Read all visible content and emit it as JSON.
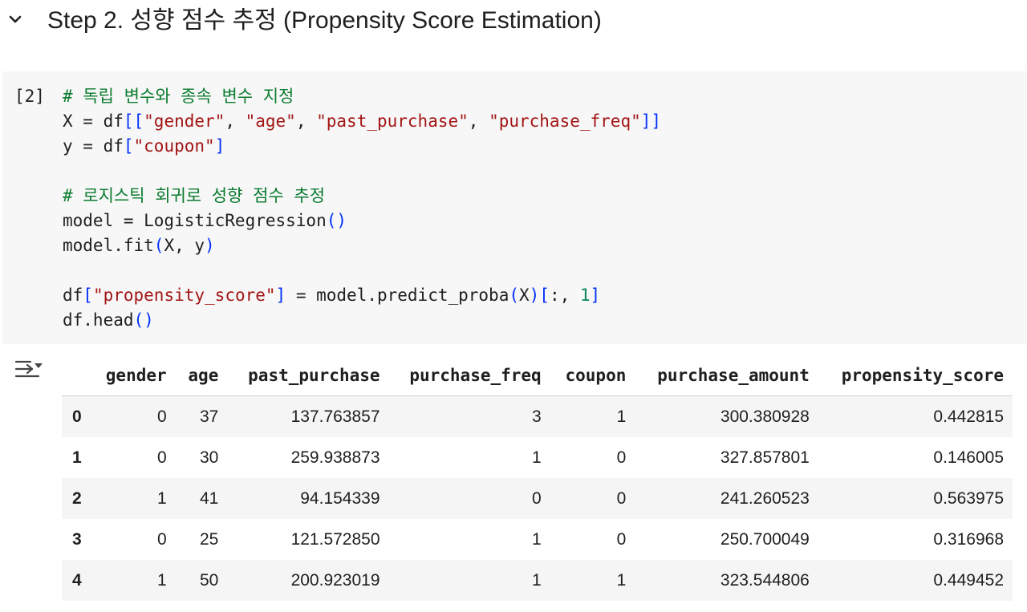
{
  "section": {
    "toggle_icon": "chevron-down-icon",
    "title": "Step 2. 성향 점수 추정 (Propensity Score Estimation)"
  },
  "code_cell": {
    "execution_count": "[2]",
    "lines": [
      [
        {
          "t": "# 독립 변수와 종속 변수 지정",
          "k": "comment"
        }
      ],
      [
        {
          "t": "X = df",
          "k": "plain"
        },
        {
          "t": "[[",
          "k": "bracket"
        },
        {
          "t": "\"gender\"",
          "k": "string"
        },
        {
          "t": ", ",
          "k": "plain"
        },
        {
          "t": "\"age\"",
          "k": "string"
        },
        {
          "t": ", ",
          "k": "plain"
        },
        {
          "t": "\"past_purchase\"",
          "k": "string"
        },
        {
          "t": ", ",
          "k": "plain"
        },
        {
          "t": "\"purchase_freq\"",
          "k": "string"
        },
        {
          "t": "]]",
          "k": "bracket"
        }
      ],
      [
        {
          "t": "y = df",
          "k": "plain"
        },
        {
          "t": "[",
          "k": "bracket"
        },
        {
          "t": "\"coupon\"",
          "k": "string"
        },
        {
          "t": "]",
          "k": "bracket"
        }
      ],
      [],
      [
        {
          "t": "# 로지스틱 회귀로 성향 점수 추정",
          "k": "comment"
        }
      ],
      [
        {
          "t": "model = LogisticRegression",
          "k": "plain"
        },
        {
          "t": "()",
          "k": "bracket"
        }
      ],
      [
        {
          "t": "model.fit",
          "k": "plain"
        },
        {
          "t": "(",
          "k": "bracket"
        },
        {
          "t": "X, y",
          "k": "plain"
        },
        {
          "t": ")",
          "k": "bracket"
        }
      ],
      [],
      [
        {
          "t": "df",
          "k": "plain"
        },
        {
          "t": "[",
          "k": "bracket"
        },
        {
          "t": "\"propensity_score\"",
          "k": "string"
        },
        {
          "t": "]",
          "k": "bracket"
        },
        {
          "t": " = model.predict_proba",
          "k": "plain"
        },
        {
          "t": "(",
          "k": "bracket"
        },
        {
          "t": "X",
          "k": "plain"
        },
        {
          "t": ")[",
          "k": "bracket"
        },
        {
          "t": ":, ",
          "k": "plain"
        },
        {
          "t": "1",
          "k": "number"
        },
        {
          "t": "]",
          "k": "bracket"
        }
      ],
      [
        {
          "t": "df.head",
          "k": "plain"
        },
        {
          "t": "()",
          "k": "bracket"
        }
      ]
    ]
  },
  "output": {
    "toggle_icon": "output-actions-icon",
    "table": {
      "columns": [
        "",
        "gender",
        "age",
        "past_purchase",
        "purchase_freq",
        "coupon",
        "purchase_amount",
        "propensity_score"
      ],
      "rows": [
        [
          "0",
          "0",
          "37",
          "137.763857",
          "3",
          "1",
          "300.380928",
          "0.442815"
        ],
        [
          "1",
          "0",
          "30",
          "259.938873",
          "1",
          "0",
          "327.857801",
          "0.146005"
        ],
        [
          "2",
          "1",
          "41",
          "94.154339",
          "0",
          "0",
          "241.260523",
          "0.563975"
        ],
        [
          "3",
          "0",
          "25",
          "121.572850",
          "1",
          "0",
          "250.700049",
          "0.316968"
        ],
        [
          "4",
          "1",
          "50",
          "200.923019",
          "1",
          "1",
          "323.544806",
          "0.449452"
        ]
      ]
    }
  },
  "colors": {
    "comment": "#0a7b2f",
    "string": "#a31515",
    "bracket": "#0431fa",
    "number": "#098658",
    "cell_background": "#f7f7f7",
    "table_stripe": "#f5f5f5"
  }
}
